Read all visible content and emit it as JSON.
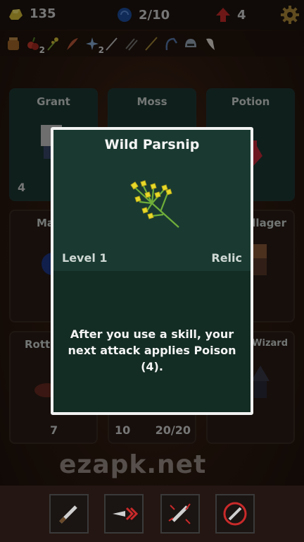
{
  "top_bar": {
    "gold": "135",
    "orbs": "2/10",
    "level_ups": "4",
    "gold_icon": "gold-icon",
    "orb_icon": "orb-icon",
    "arrow_icon": "level-up-icon",
    "settings_icon": "gear-icon"
  },
  "relics": [
    {
      "icon": "jar-icon",
      "count": ""
    },
    {
      "icon": "berry-icon",
      "count": "2"
    },
    {
      "icon": "herb-icon",
      "count": ""
    },
    {
      "icon": "feather-icon",
      "count": ""
    },
    {
      "icon": "star-icon",
      "count": "2"
    },
    {
      "icon": "dagger-icon",
      "count": ""
    },
    {
      "icon": "claws-icon",
      "count": ""
    },
    {
      "icon": "sword-icon",
      "count": ""
    },
    {
      "icon": "hook-icon",
      "count": ""
    },
    {
      "icon": "helmet-icon",
      "count": ""
    },
    {
      "icon": "tooth-icon",
      "count": ""
    }
  ],
  "cards": {
    "grant": {
      "name": "Grant",
      "stat": "4"
    },
    "moss": {
      "name": "Moss"
    },
    "potion": {
      "name": "Potion"
    },
    "mage": {
      "name": "Ma"
    },
    "villager": {
      "name": "Villager"
    },
    "rotten": {
      "name": "Rotte",
      "stat": "7"
    },
    "middle_bottom": {
      "stat_left": "10",
      "stat_right": "20/20"
    },
    "wizard": {
      "name": "g Wizard"
    }
  },
  "modal": {
    "title": "Wild Parsnip",
    "level": "Level 1",
    "type": "Relic",
    "description": "After you use a skill, your next attack applies Poison (4).",
    "image_icon": "wild-parsnip-icon"
  },
  "watermark": "ezapk.net",
  "skills": [
    {
      "icon": "dagger-skill-icon"
    },
    {
      "icon": "dash-skill-icon"
    },
    {
      "icon": "spark-skill-icon"
    },
    {
      "icon": "vortex-skill-icon"
    }
  ],
  "colors": {
    "modal_bg": "#132c24",
    "modal_border": "#f2f2f2",
    "card_bg": "#1d3a33",
    "herb": "#e8d92a",
    "stem": "#6fae3a"
  }
}
